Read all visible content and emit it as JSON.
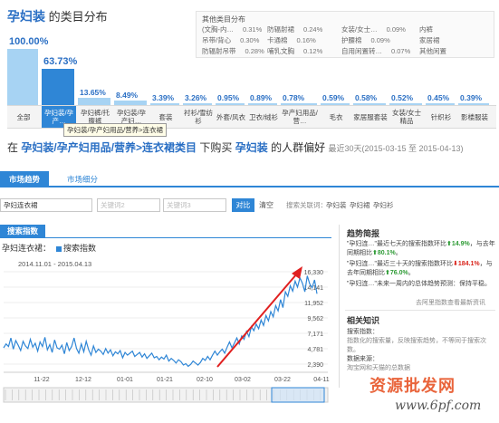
{
  "category_dist": {
    "title_highlight": "孕妇装",
    "title_rest": " 的类目分布",
    "other_title": "其他类目分布",
    "other": [
      [
        "(文胸-内…",
        "0.31%"
      ],
      [
        "防辐射裙",
        "0.24%"
      ],
      [
        "女装/女士…",
        "0.09%"
      ],
      [
        "内裤",
        ""
      ],
      [
        "吊带/背心",
        "0.30%"
      ],
      [
        "卡通棉",
        "0.16%"
      ],
      [
        "护腰棉",
        "0.09%"
      ],
      [
        "家居裙",
        ""
      ],
      [
        "防辐射吊带",
        "0.28%"
      ],
      [
        "哺乳文胸",
        "0.12%"
      ],
      [
        "自用闲置转…",
        "0.07%"
      ],
      [
        "其他闲置",
        ""
      ]
    ],
    "bars": [
      {
        "pct": "100.00%",
        "value": 100.0,
        "label": "全部"
      },
      {
        "pct": "63.73%",
        "value": 63.73,
        "label": "孕妇装/孕产…"
      },
      {
        "pct": "13.65%",
        "value": 13.65,
        "label": "孕妇裤/托腹裤"
      },
      {
        "pct": "8.49%",
        "value": 8.49,
        "label": "孕妇装/孕产妇…"
      },
      {
        "pct": "3.39%",
        "value": 3.39,
        "label": "套装"
      },
      {
        "pct": "3.26%",
        "value": 3.26,
        "label": "衬衫/雪纺衫"
      },
      {
        "pct": "0.95%",
        "value": 0.95,
        "label": "外套/风衣"
      },
      {
        "pct": "0.89%",
        "value": 0.89,
        "label": "卫衣/绒衫"
      },
      {
        "pct": "0.78%",
        "value": 0.78,
        "label": "孕产妇用品/营…"
      },
      {
        "pct": "0.59%",
        "value": 0.59,
        "label": "毛衣"
      },
      {
        "pct": "0.58%",
        "value": 0.58,
        "label": "家居服套装"
      },
      {
        "pct": "0.52%",
        "value": 0.52,
        "label": "女装/女士精品"
      },
      {
        "pct": "0.45%",
        "value": 0.45,
        "label": "针织衫"
      },
      {
        "pct": "0.39%",
        "value": 0.39,
        "label": "影楼服装"
      }
    ],
    "tooltip": "孕妇装/孕产妇用品/营养>连衣裙"
  },
  "heading": {
    "prefix": "在",
    "path": "孕妇装/孕产妇用品/营养>连衣裙类目",
    "mid": "下购买",
    "kw": "孕妇装",
    "suffix": "的人群偏好",
    "range": "最近30天(2015-03-15 至 2015-04-13)"
  },
  "tabs": [
    "市场趋势",
    "市场细分"
  ],
  "keywords": {
    "kw1": "孕妇连衣裙",
    "kw2_placeholder": "关键词2",
    "kw3_placeholder": "关键词3",
    "compare": "对比",
    "clear": "清空",
    "rec_label": "搜索关联词：",
    "recs": [
      "孕妇装",
      "孕妇裙",
      "孕妇衫"
    ]
  },
  "search_index": {
    "tab": "搜索指数",
    "chart_label": "孕妇连衣裙：",
    "legend": "搜索指数",
    "date_range": "2014.11.01 - 2015.04.13"
  },
  "chart_data": {
    "type": "line",
    "series": [
      {
        "name": "搜索指数",
        "values": [
          3700,
          4300,
          3900,
          5200,
          3500,
          4800,
          4100,
          3300,
          4700,
          4000,
          3600,
          5000,
          3800,
          4400,
          3200,
          4600,
          3900,
          5300,
          3400,
          4200,
          3000,
          4900,
          3700,
          3500,
          4100,
          2800,
          4500,
          3300,
          3900,
          5200,
          3600,
          2900,
          4300,
          3100,
          4700,
          3400,
          2600,
          4000,
          3000,
          3500,
          3200,
          2700,
          3600,
          2900,
          3400,
          2500,
          3100,
          2800,
          3300,
          2200,
          3000,
          2600,
          2900,
          3200,
          2400,
          2700,
          3000,
          2300,
          2800,
          2100,
          2500,
          2900,
          2200,
          2400,
          1900,
          2300,
          2000,
          2600,
          1700,
          2100,
          1800,
          1400,
          1900,
          1600,
          1100,
          1300,
          900,
          1200,
          1700,
          1400,
          1100,
          1500,
          2100,
          1800,
          2400,
          1900,
          2600,
          3200,
          2600,
          3100,
          3500,
          2900,
          3800,
          4600,
          3700,
          4400,
          5200,
          4300,
          5500,
          5000,
          6200,
          5400,
          6900,
          6300,
          7300,
          6600,
          7900,
          7100,
          8600,
          7800,
          9200,
          8400,
          10100,
          9300,
          11000,
          9800,
          12200,
          11500,
          13100,
          12300,
          13800,
          12900,
          14300,
          13500,
          12200,
          14600,
          13400,
          12800,
          14000,
          11900
        ]
      }
    ],
    "x_ticks": [
      "11-22",
      "12-12",
      "01-01",
      "01-21",
      "02-10",
      "03-02",
      "03-22",
      "04-11"
    ],
    "y_ticks": [
      "16,330",
      "14,141",
      "11,952",
      "9,562",
      "7,171",
      "4,781",
      "2,390"
    ],
    "ylim": [
      0,
      16330
    ]
  },
  "right": {
    "title": "趋势简报",
    "items": [
      {
        "kw": "\"孕妇连…",
        "text": "\"最近七天的搜索指数环比",
        "dir": "up",
        "v1": "14.9%",
        "mid": "，与去年同期相比",
        "v2": "80.1%",
        "end": "。"
      },
      {
        "kw": "\"孕妇连…",
        "text": "\"最近三十天的搜索指数环比",
        "dir": "down",
        "v1": "184.1%",
        "mid": "，与去年同期相比",
        "v2": "76.0%",
        "end": "。"
      },
      {
        "kw": "\"孕妇连…",
        "text": "\"未来一周内的总体趋势预测：保持平稳。",
        "dir": "",
        "v1": "",
        "mid": "",
        "v2": "",
        "end": ""
      }
    ],
    "link": "去阿里指数查看最新资讯",
    "know_title": "相关知识",
    "know_lines": [
      "搜索指数：",
      "指数化的搜索量，反映搜索趋势，不等同于搜索次数。",
      "数据来源：",
      "淘宝网和天猫的总数据"
    ]
  },
  "watermark": {
    "cn": "资源批发网",
    "url": "www.6pf.com"
  }
}
